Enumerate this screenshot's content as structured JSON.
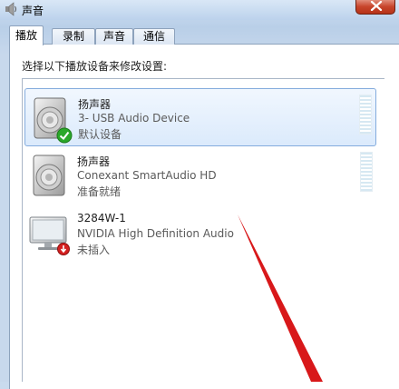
{
  "window": {
    "title": "声音"
  },
  "tabs": [
    {
      "label": "播放"
    },
    {
      "label": "录制"
    },
    {
      "label": "声音"
    },
    {
      "label": "通信"
    }
  ],
  "playback": {
    "instruction": "选择以下播放设备来修改设置:",
    "devices": [
      {
        "name": "扬声器",
        "description": "3- USB Audio Device",
        "status": "默认设备",
        "icon": "speaker-icon",
        "badge": "default-check-icon"
      },
      {
        "name": "扬声器",
        "description": "Conexant SmartAudio HD",
        "status": "准备就绪",
        "icon": "speaker-icon",
        "badge": ""
      },
      {
        "name": "3284W-1",
        "description": "NVIDIA High Definition Audio",
        "status": "未插入",
        "icon": "monitor-icon",
        "badge": "unplugged-icon"
      }
    ]
  },
  "colors": {
    "selection": "#dbeafc",
    "check": "#2aa82a",
    "unplugged": "#d42020",
    "arrow": "#d8181a"
  }
}
